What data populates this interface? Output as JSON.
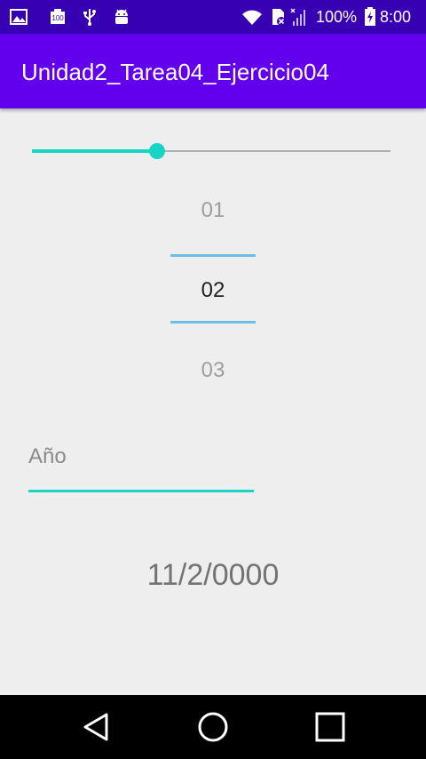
{
  "status_bar": {
    "icons_left": [
      "image-icon",
      "battery-100-icon",
      "usb-icon",
      "android-debug-icon"
    ],
    "icons_right": [
      "wifi-icon",
      "sim-no-service-icon",
      "signal-icon",
      "battery-icon"
    ],
    "battery_text": "100%",
    "time": "8:00"
  },
  "app_bar": {
    "title": "Unidad2_Tarea04_Ejercicio04"
  },
  "slider": {
    "value_fraction": 0.35
  },
  "picker": {
    "prev": "01",
    "current": "02",
    "next": "03"
  },
  "year_field": {
    "placeholder": "Año",
    "value": ""
  },
  "result": {
    "date_text": "11/2/0000"
  },
  "nav_bar": {
    "icons": [
      "back-icon",
      "home-icon",
      "recents-icon"
    ]
  },
  "colors": {
    "status_bar": "#3700b3",
    "app_bar": "#6200ee",
    "accent": "#16d6c3",
    "picker_divider": "#6dbde6",
    "background": "#eeeeee"
  }
}
